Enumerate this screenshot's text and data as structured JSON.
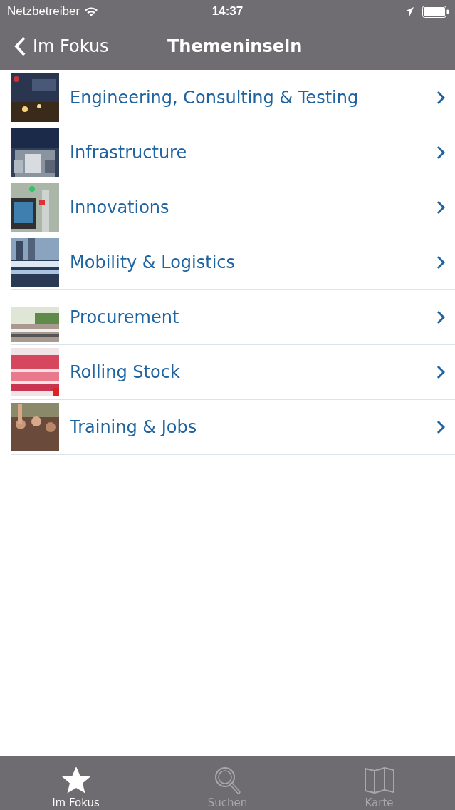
{
  "status_bar": {
    "carrier": "Netzbetreiber",
    "time": "14:37"
  },
  "nav_bar": {
    "back": "Im Fokus",
    "title": "Themeninseln"
  },
  "list": [
    {
      "label": "Engineering, Consulting & Testing"
    },
    {
      "label": "Infrastructure"
    },
    {
      "label": "Innovations"
    },
    {
      "label": "Mobility & Logistics"
    },
    {
      "label": "Procurement"
    },
    {
      "label": "Rolling Stock"
    },
    {
      "label": "Training & Jobs"
    }
  ],
  "tab_bar": [
    {
      "label": "Im Fokus",
      "selected": true
    },
    {
      "label": "Suchen",
      "selected": false
    },
    {
      "label": "Karte",
      "selected": false
    }
  ]
}
